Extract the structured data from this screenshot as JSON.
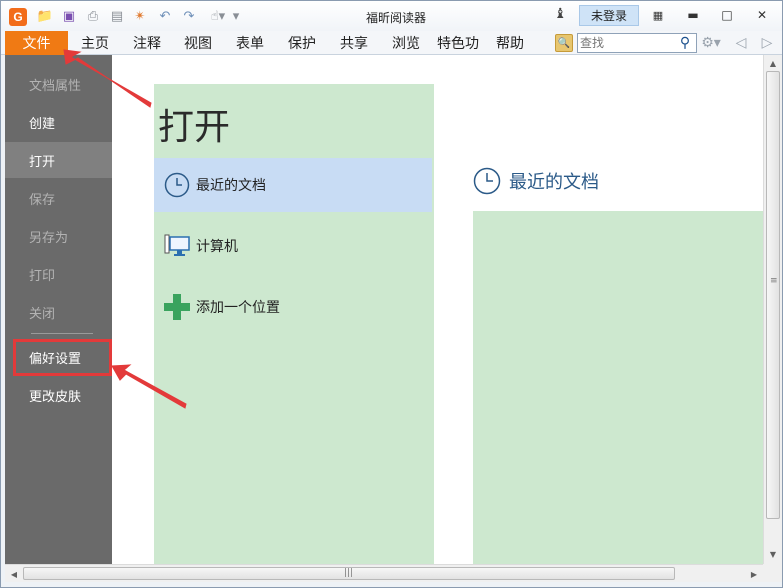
{
  "window": {
    "app_logo": "G",
    "title": "福昕阅读器",
    "login_label": "未登录"
  },
  "menu": {
    "tabs": [
      "文件",
      "主页",
      "注释",
      "视图",
      "表单",
      "保护",
      "共享",
      "浏览",
      "特色功",
      "帮助"
    ],
    "search_placeholder": "查找"
  },
  "sidebar": {
    "items": [
      "文档属性",
      "创建",
      "打开",
      "保存",
      "另存为",
      "打印",
      "关闭",
      "偏好设置",
      "更改皮肤"
    ]
  },
  "open_panel": {
    "title": "打开",
    "items": [
      "最近的文档",
      "计算机",
      "添加一个位置"
    ]
  },
  "recent": {
    "title": "最近的文档"
  },
  "colors": {
    "file_tab": "#f07a14",
    "sidebar": "#6a6a6a",
    "panel_green": "#cde8cf",
    "selected_blue": "#c8dcf4",
    "annotation_red": "#e33a3a"
  }
}
